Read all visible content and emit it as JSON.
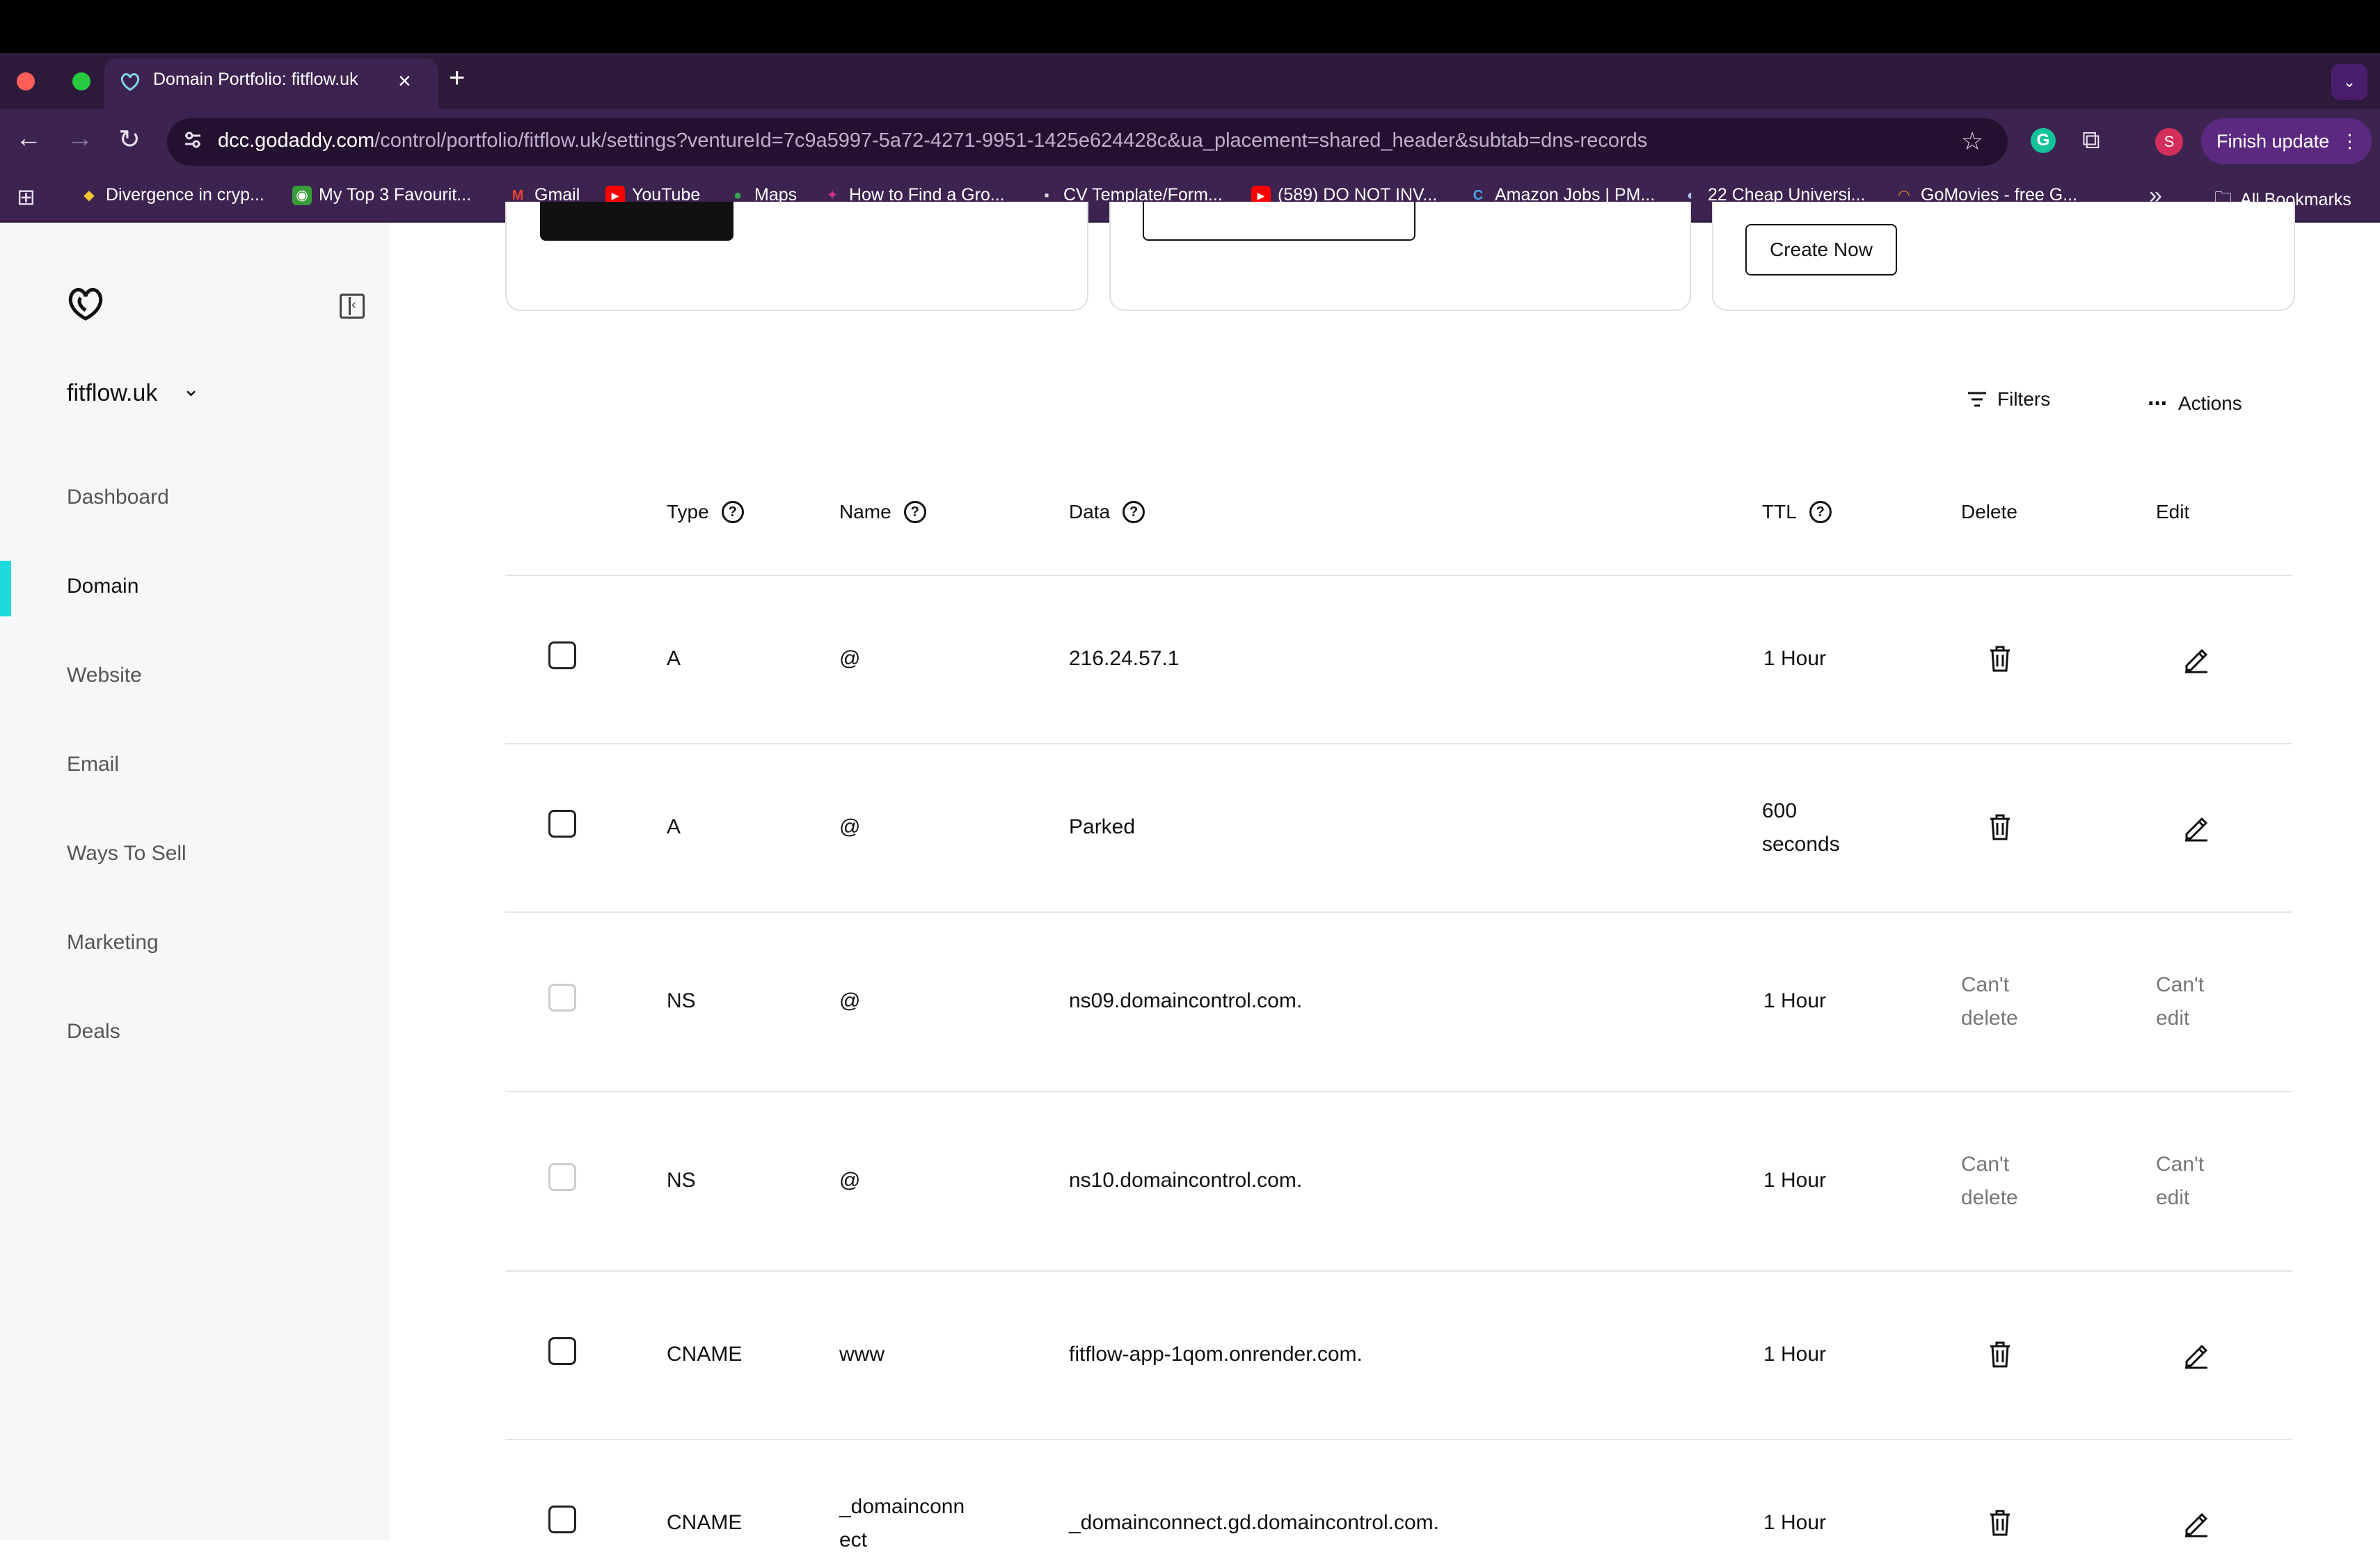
{
  "browser": {
    "tab_title": "Domain Portfolio: fitflow.uk",
    "url_domain": "dcc.godaddy.com",
    "url_path": "/control/portfolio/fitflow.uk/settings?ventureId=7c9a5997-5a72-4271-9951-1425e624428c&ua_placement=shared_header&subtab=dns-records",
    "profile_initial": "S",
    "finish_update_label": "Finish update",
    "bookmarks": [
      "Divergence in cryp...",
      "My Top 3 Favourit...",
      "Gmail",
      "YouTube",
      "Maps",
      "How to Find a Gro...",
      "CV Template/Form...",
      "(589) DO NOT INV...",
      "Amazon Jobs | PM...",
      "22 Cheap Universi...",
      "GoMovies - free G..."
    ],
    "all_bookmarks_label": "All Bookmarks"
  },
  "sidebar": {
    "domain": "fitflow.uk",
    "items": [
      {
        "label": "Dashboard"
      },
      {
        "label": "Domain"
      },
      {
        "label": "Website"
      },
      {
        "label": "Email"
      },
      {
        "label": "Ways To Sell"
      },
      {
        "label": "Marketing"
      },
      {
        "label": "Deals"
      }
    ],
    "active_item": "Domain",
    "accent_color": "#1bdbdb"
  },
  "cards": {
    "create_now_label": "Create Now"
  },
  "toolbar": {
    "filters_label": "Filters",
    "actions_label": "Actions"
  },
  "table": {
    "headers": {
      "type": "Type",
      "name": "Name",
      "data": "Data",
      "ttl": "TTL",
      "delete": "Delete",
      "edit": "Edit"
    },
    "rows": [
      {
        "type": "A",
        "name": "@",
        "data": "216.24.57.1",
        "ttl": "1 Hour",
        "ttl2": "",
        "deletable": true
      },
      {
        "type": "A",
        "name": "@",
        "data": "Parked",
        "ttl": "600",
        "ttl2": "seconds",
        "deletable": true
      },
      {
        "type": "NS",
        "name": "@",
        "data": "ns09.domaincontrol.com.",
        "ttl": "1 Hour",
        "ttl2": "",
        "deletable": false,
        "cant_delete_1": "Can't",
        "cant_delete_2": "delete",
        "cant_edit_1": "Can't",
        "cant_edit_2": "edit"
      },
      {
        "type": "NS",
        "name": "@",
        "data": "ns10.domaincontrol.com.",
        "ttl": "1 Hour",
        "ttl2": "",
        "deletable": false,
        "cant_delete_1": "Can't",
        "cant_delete_2": "delete",
        "cant_edit_1": "Can't",
        "cant_edit_2": "edit"
      },
      {
        "type": "CNAME",
        "name": "www",
        "data": "fitflow-app-1qom.onrender.com.",
        "ttl": "1 Hour",
        "ttl2": "",
        "deletable": true
      },
      {
        "type": "CNAME",
        "name": "_domainconn",
        "name2": "ect",
        "data": "_domainconnect.gd.domaincontrol.com.",
        "ttl": "1 Hour",
        "ttl2": "",
        "deletable": true
      }
    ]
  }
}
